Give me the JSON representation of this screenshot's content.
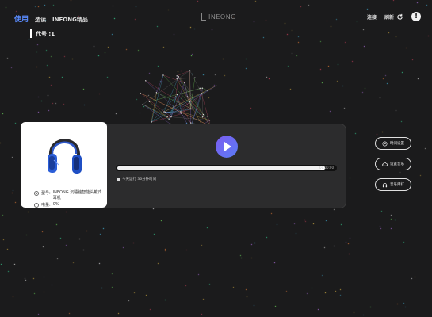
{
  "nav": {
    "items": [
      {
        "label": "使用",
        "active": true
      },
      {
        "label": "选读",
        "active": false
      },
      {
        "label": "INEONG精品",
        "active": false
      }
    ]
  },
  "logo": {
    "text": "INEONG"
  },
  "top_right": {
    "item1": "连接",
    "refresh": "刷新",
    "alert": "!"
  },
  "device": {
    "code": "代号 :1"
  },
  "product": {
    "name_label": "型号:",
    "name_value": "INEONG 沉睡脑智能头戴式耳机",
    "battery_label": "电量:",
    "battery_value": "0%"
  },
  "player": {
    "progress": 0.94,
    "time": "00:00:00",
    "desc": "今天运行 36分钟时间"
  },
  "side_buttons": [
    {
      "label": "时间设置",
      "icon": "clock-icon"
    },
    {
      "label": "设置音乐",
      "icon": "cloud-music-icon"
    },
    {
      "label": "音乐库打",
      "icon": "headset-icon"
    }
  ],
  "colors": {
    "accent": "#5a8cff",
    "background": "#1b1b1c",
    "play_start": "#7c5cf0",
    "play_end": "#5a7cf5"
  }
}
